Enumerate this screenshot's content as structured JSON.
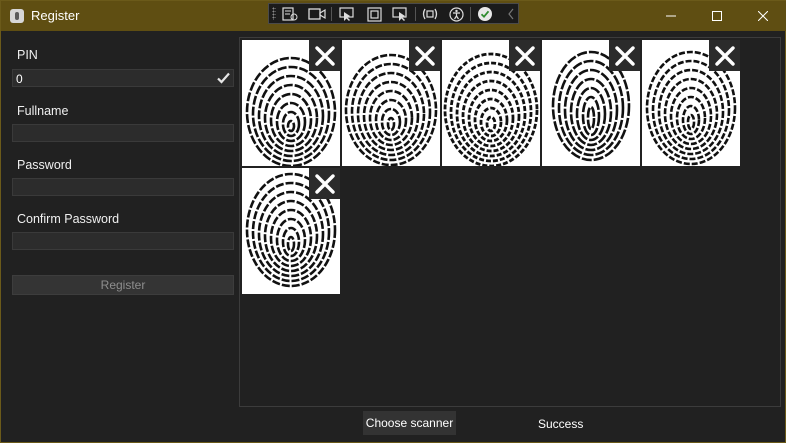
{
  "window": {
    "title": "Register"
  },
  "toolbar": {
    "icons": [
      "live-visual-tree-icon",
      "video-icon",
      "select-element-icon",
      "display-layout-adorners-icon",
      "track-focused-element-icon",
      "binding-failures-icon",
      "accessibility-icon",
      "checkmark-icon",
      "collapse-chevron-icon"
    ]
  },
  "form": {
    "pin": {
      "label": "PIN",
      "value": "0"
    },
    "fullname": {
      "label": "Fullname",
      "value": ""
    },
    "password": {
      "label": "Password",
      "value": ""
    },
    "confirm_password": {
      "label": "Confirm Password",
      "value": ""
    },
    "register_label": "Register"
  },
  "fingerprints": {
    "count": 6,
    "remove_icon": "close-icon"
  },
  "footer": {
    "choose_scanner_label": "Choose scanner",
    "status_text": "Success"
  },
  "colors": {
    "titlebar": "#5f4e12",
    "background": "#212121",
    "field": "#2c2c2c"
  }
}
